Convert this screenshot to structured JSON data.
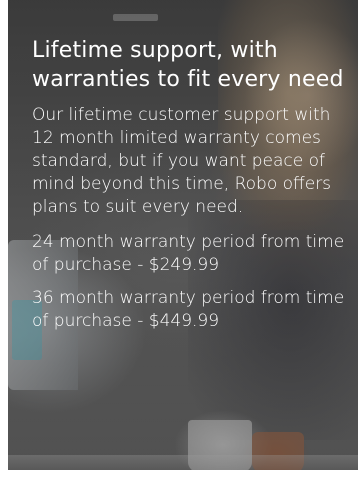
{
  "promo": {
    "heading": "Lifetime support, with warranties to fit every need",
    "intro": "Our lifetime customer support with 12 month limited warranty comes standard, but if you want peace of mind beyond this time, Robo offers plans to suit every need.",
    "plans": [
      {
        "text": "24 month warranty period from time of purchase - $249.99"
      },
      {
        "text": "36 month warranty period from time of purchase - $449.99"
      }
    ]
  }
}
